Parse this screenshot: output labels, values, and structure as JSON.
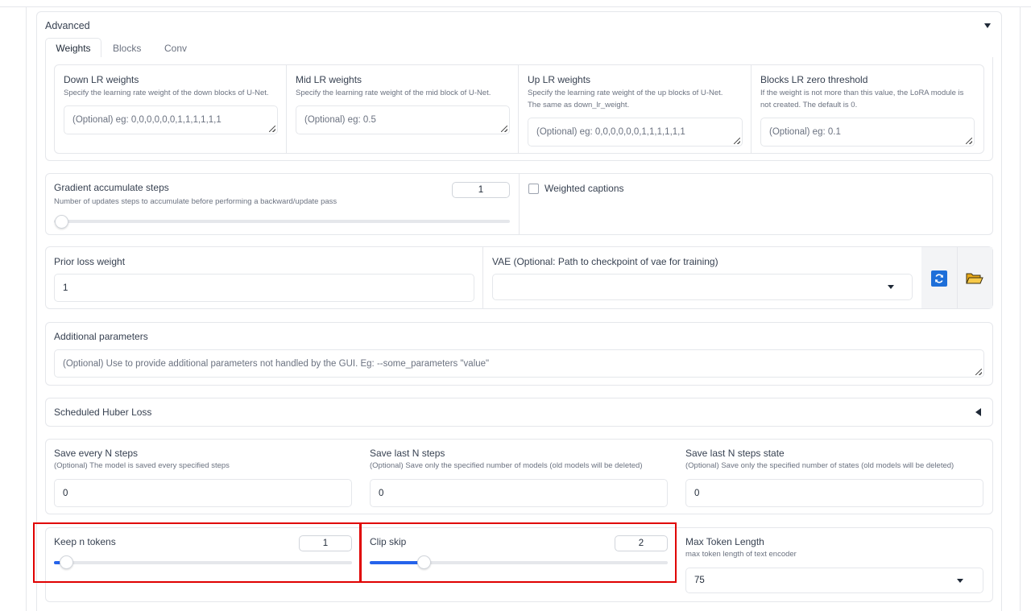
{
  "accordion": {
    "title": "Advanced"
  },
  "tabs": [
    {
      "label": "Weights",
      "active": true
    },
    {
      "label": "Blocks",
      "active": false
    },
    {
      "label": "Conv",
      "active": false
    }
  ],
  "weights": {
    "down": {
      "label": "Down LR weights",
      "hint": "Specify the learning rate weight of the down blocks of U-Net.",
      "placeholder": "(Optional) eg: 0,0,0,0,0,0,1,1,1,1,1,1"
    },
    "mid": {
      "label": "Mid LR weights",
      "hint": "Specify the learning rate weight of the mid block of U-Net.",
      "placeholder": "(Optional) eg: 0.5"
    },
    "up": {
      "label": "Up LR weights",
      "hint_line1": "Specify the learning rate weight of the up blocks of U-Net.",
      "hint_line2": "The same as down_lr_weight.",
      "placeholder": "(Optional) eg: 0,0,0,0,0,0,1,1,1,1,1,1"
    },
    "zero": {
      "label": "Blocks LR zero threshold",
      "hint_line1": "If the weight is not more than this value, the LoRA module is",
      "hint_line2": "not created. The default is 0.",
      "placeholder": "(Optional) eg: 0.1"
    }
  },
  "gradient": {
    "label": "Gradient accumulate steps",
    "hint": "Number of updates steps to accumulate before performing a backward/update pass",
    "value": "1",
    "slider_fraction": 0.0
  },
  "weighted_captions": {
    "label": "Weighted captions",
    "checked": false
  },
  "prior_loss": {
    "label": "Prior loss weight",
    "value": "1"
  },
  "vae": {
    "label": "VAE (Optional: Path to checkpoint of vae for training)",
    "value": "",
    "refresh_icon": "refresh-icon",
    "folder_icon": "folder-icon"
  },
  "additional": {
    "label": "Additional parameters",
    "placeholder": "(Optional) Use to provide additional parameters not handled by the GUI. Eg: --some_parameters \"value\""
  },
  "huber": {
    "label": "Scheduled Huber Loss",
    "expanded": false
  },
  "save_every": {
    "label": "Save every N steps",
    "hint": "(Optional) The model is saved every specified steps",
    "value": "0"
  },
  "save_last": {
    "label": "Save last N steps",
    "hint": "(Optional) Save only the specified number of models (old models will be deleted)",
    "value": "0"
  },
  "save_last_state": {
    "label": "Save last N steps state",
    "hint": "(Optional) Save only the specified number of states (old models will be deleted)",
    "value": "0"
  },
  "keep_tokens": {
    "label": "Keep n tokens",
    "value": "1",
    "slider_fraction": 0.04
  },
  "clip_skip": {
    "label": "Clip skip",
    "value": "2",
    "slider_fraction": 0.18
  },
  "max_token": {
    "label": "Max Token Length",
    "hint": "max token length of text encoder",
    "value": "75"
  },
  "colors": {
    "accent": "#2563eb",
    "highlight": "#e00000",
    "border": "#e5e7eb"
  }
}
